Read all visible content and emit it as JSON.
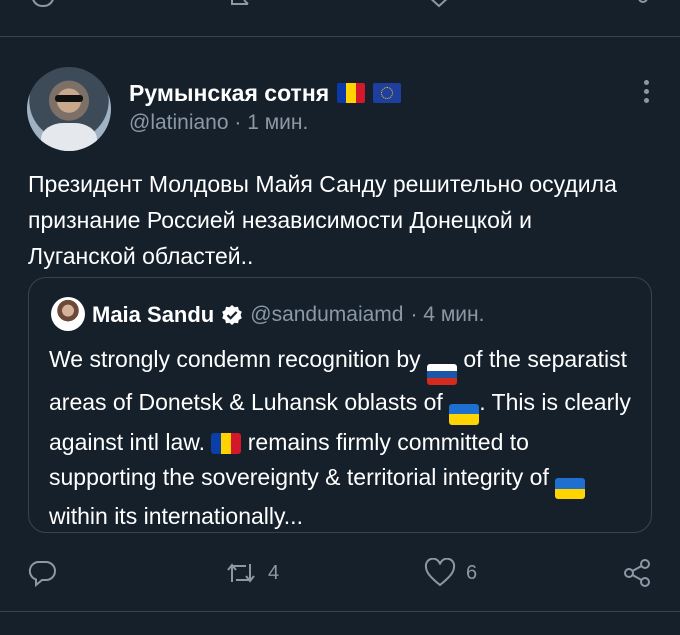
{
  "tweet": {
    "display_name": "Румынская сотня",
    "handle": "@latiniano",
    "time": "· 1 мин.",
    "text": "Президент Молдовы Майя Санду решительно осудила признание Россией независимости Донецкой и Луганской областей..",
    "more_icon": "more-dots-icon",
    "name_flags": [
      "romania-flag",
      "eu-flag"
    ]
  },
  "quote": {
    "display_name": "Maia Sandu",
    "handle": "@sandumaiamd",
    "time": "· 4 мин.",
    "text_parts": {
      "p1": "We strongly condemn recognition by ",
      "p2": " of the separatist areas of Donetsk & Luhansk oblasts of ",
      "p3": ". This is clearly against intl law. ",
      "p4": " remains firmly committed to supporting the sovereignty & territorial integrity of ",
      "p5": " within its internationally..."
    },
    "verified_icon": "verified-badge-icon"
  },
  "actions": {
    "reply_count": "",
    "retweet_count": "4",
    "like_count": "6",
    "icons": [
      "reply-icon",
      "retweet-icon",
      "like-icon",
      "share-icon"
    ]
  },
  "colors": {
    "background": "#15202b",
    "border": "#38444d",
    "muted": "#8b98a5",
    "text": "#ffffff"
  }
}
